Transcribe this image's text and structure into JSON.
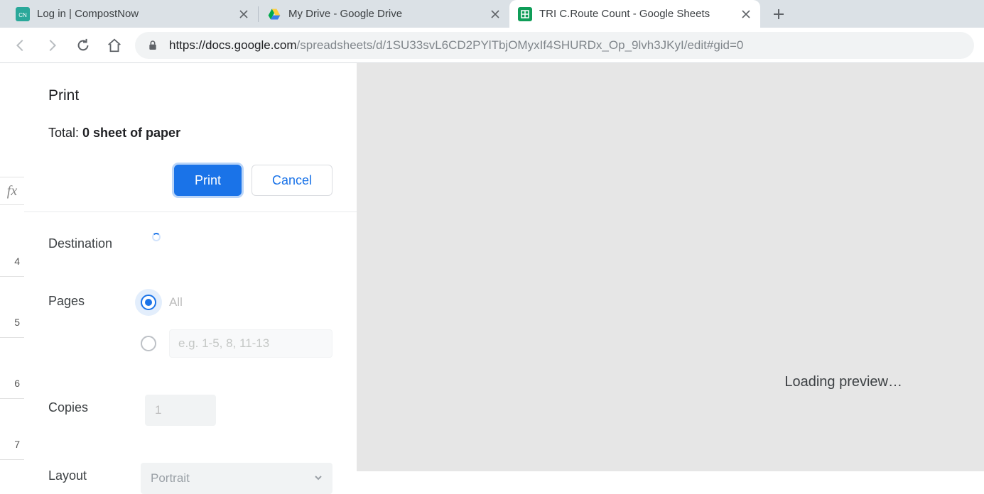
{
  "tabs": [
    {
      "title": "Log in | CompostNow"
    },
    {
      "title": "My Drive - Google Drive"
    },
    {
      "title": "TRI C.Route Count - Google Sheets"
    }
  ],
  "activeTabIndex": 2,
  "url": {
    "secure_prefix": "https://docs.google.com",
    "path": "/spreadsheets/d/1SU33svL6CD2PYlTbjOMyxIf4SHURDx_Op_9lvh3JKyI/edit#gid=0"
  },
  "sheet": {
    "visible_row_numbers": [
      "4",
      "5",
      "6",
      "7"
    ]
  },
  "print": {
    "title": "Print",
    "total_prefix": "Total: ",
    "total_value": "0 sheet of paper",
    "buttons": {
      "print": "Print",
      "cancel": "Cancel"
    },
    "destination_label": "Destination",
    "pages_label": "Pages",
    "pages_all": "All",
    "pages_range_placeholder": "e.g. 1-5, 8, 11-13",
    "copies_label": "Copies",
    "copies_value": "1",
    "layout_label": "Layout",
    "layout_value": "Portrait"
  },
  "preview": {
    "loading": "Loading preview…"
  }
}
